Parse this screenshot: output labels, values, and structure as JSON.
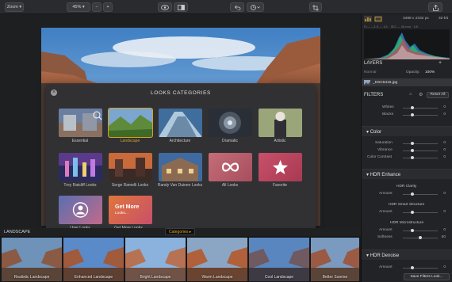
{
  "toolbar": {
    "zoom_label": "Zoom",
    "zoom_value": "45%",
    "zoom_minus": "−",
    "zoom_plus": "+"
  },
  "modal": {
    "title": "LOOKS CATEGORIES",
    "close": "×",
    "tiles": [
      {
        "label": "Essential"
      },
      {
        "label": "Landscape"
      },
      {
        "label": "Architecture"
      },
      {
        "label": "Dramatic"
      },
      {
        "label": "Artistic"
      },
      {
        "label": "Trey Ratcliff Looks"
      },
      {
        "label": "Serge Ramelli Looks"
      },
      {
        "label": "Randy Van Duinen Looks"
      },
      {
        "label": "All Looks"
      },
      {
        "label": "Favorite"
      },
      {
        "label": "User Looks"
      },
      {
        "label": "Get More Looks..."
      }
    ],
    "get_more_title": "Get More",
    "get_more_sub": "Looks..."
  },
  "filmstrip": {
    "category": "LANDSCAPE",
    "categories_button": "Categories ▸",
    "items": [
      {
        "label": "Realistic Landscape"
      },
      {
        "label": "Enhanced Landscape"
      },
      {
        "label": "Bright Landscape"
      },
      {
        "label": "Warm Landscape"
      },
      {
        "label": "Cool Landscape"
      },
      {
        "label": "Better Sunrise"
      }
    ]
  },
  "panel": {
    "dims": "3488 x 2332 px",
    "bitdepth": "32-bit",
    "exif": "F/— —1.5 — 1/1 · ISO — 36 mm · 1/5",
    "layers_label": "LAYERS",
    "blend_mode": "Normal",
    "opacity_label": "Opacity:",
    "opacity_value": "100%",
    "layer_name": "_DSC6416.jpg",
    "filters_label": "FILTERS",
    "reset_all": "Reset All",
    "basic_sliders": [
      {
        "label": "Whites",
        "value": "0"
      },
      {
        "label": "Blacks",
        "value": "0"
      }
    ],
    "color_label": "Color",
    "color_sliders": [
      {
        "label": "Saturation",
        "value": "0"
      },
      {
        "label": "Vibrance",
        "value": "0"
      },
      {
        "label": "Color Contrast",
        "value": "0"
      }
    ],
    "hdr_enhance_label": "HDR Enhance",
    "hdr_clarity_label": "HDR Clarity",
    "hdr_clarity_amount": {
      "label": "Amount",
      "value": "0"
    },
    "hdr_smart_label": "HDR Smart Structure",
    "hdr_smart_amount": {
      "label": "Amount",
      "value": "0"
    },
    "hdr_micro_label": "HDR Microstructure",
    "hdr_micro_amount": {
      "label": "Amount",
      "value": "0"
    },
    "hdr_micro_softness": {
      "label": "Softness",
      "value": "50"
    },
    "hdr_denoise_label": "HDR Denoise",
    "hdr_denoise_amount": {
      "label": "Amount",
      "value": "0"
    },
    "save_filters": "Save Filters Look..."
  },
  "colors": {
    "accent": "#d8a020",
    "panel_bg": "#222326",
    "toolbar_bg": "#2a2b2e"
  }
}
